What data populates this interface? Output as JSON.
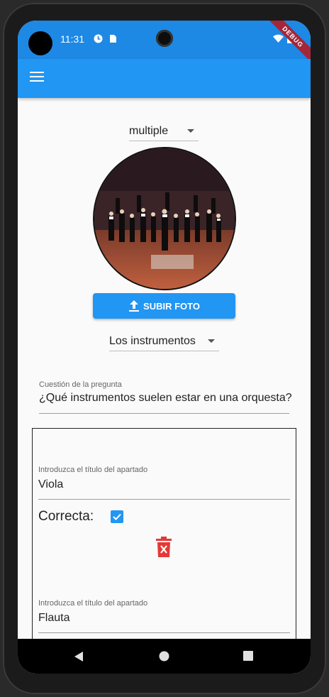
{
  "status_bar": {
    "time": "11:31",
    "debug_label": "DEBUG",
    "icons": [
      "clock-icon",
      "sim-icon",
      "wifi-icon",
      "battery-icon"
    ]
  },
  "app_bar": {
    "menu_icon": "menu-icon",
    "color": "#2196f3"
  },
  "type_dropdown": {
    "value": "multiple"
  },
  "photo": {
    "alt": "orchestra-photo"
  },
  "upload_button": {
    "label": "SUBIR FOTO",
    "icon": "upload-icon"
  },
  "category_dropdown": {
    "value": "Los instrumentos"
  },
  "question": {
    "label": "Cuestión de la pregunta",
    "value": "¿Qué instrumentos suelen estar en una orquesta?"
  },
  "options": [
    {
      "label": "Introduzca el título del apartado",
      "value": "Viola",
      "correct_label": "Correcta:",
      "correct": true,
      "delete_icon": "delete-icon"
    },
    {
      "label": "Introduzca el título del apartado",
      "value": "Flauta"
    }
  ],
  "nav_bar": {
    "icons": [
      "back-icon",
      "home-icon",
      "recents-icon"
    ]
  }
}
